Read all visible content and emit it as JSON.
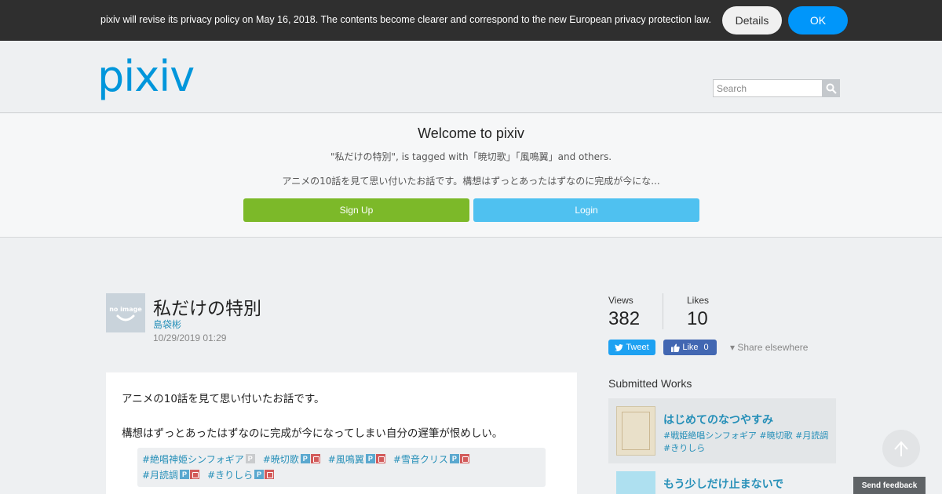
{
  "privacy_bar": {
    "message": "pixiv will revise its privacy policy on May 16, 2018. The contents become clearer and correspond to the new European privacy protection law.",
    "details_label": "Details",
    "ok_label": "OK"
  },
  "header": {
    "logo": "pixiv",
    "search_placeholder": "Search"
  },
  "welcome": {
    "title": "Welcome to pixiv",
    "tags_line": "\"私だけの特別\", is tagged with「暁切歌」「風鳴翼」and others.",
    "description": "アニメの10話を見て思い付いたお話です。構想はずっとあったはずなのに完成が今にな...",
    "signup_label": "Sign Up",
    "login_label": "Login"
  },
  "work": {
    "avatar_text": "no image",
    "title": "私だけの特別",
    "author": "島袋彬",
    "date": "10/29/2019 01:29",
    "caption_1": "アニメの10話を見て思い付いたお話です。",
    "caption_2": "構想はずっとあったはずなのに完成が今になってしまい自分の遅筆が恨めしい。",
    "tags": [
      {
        "text": "#絶唱神姫シンフォギア",
        "p_badge": "grey",
        "lock": false
      },
      {
        "text": "#暁切歌",
        "p_badge": "blue",
        "lock": true
      },
      {
        "text": "#風鳴翼",
        "p_badge": "blue",
        "lock": true
      },
      {
        "text": "#雪音クリス",
        "p_badge": "blue",
        "lock": true
      },
      {
        "text": "#月読調",
        "p_badge": "blue",
        "lock": true
      },
      {
        "text": "#きりしら",
        "p_badge": "blue",
        "lock": true
      }
    ],
    "p_badge_char": "P"
  },
  "stats": {
    "views_label": "Views",
    "views_value": "382",
    "likes_label": "Likes",
    "likes_value": "10"
  },
  "share": {
    "tweet_label": "Tweet",
    "like_label": "Like",
    "like_count": "0",
    "share_else_label": "▾ Share elsewhere"
  },
  "submitted": {
    "heading": "Submitted Works",
    "items": [
      {
        "title": "はじめてのなつやすみ",
        "tags": "#戦姫絶唱シンフォギア #暁切歌 #月読調 #きりしら"
      },
      {
        "title": "もう少しだけ止まないで"
      }
    ]
  },
  "feedback_label": "Send feedback",
  "colors": {
    "brand": "#0096db",
    "ok_button": "#0096fa",
    "signup_button": "#7cb929",
    "login_button": "#4fc1f0",
    "link": "#258fb8",
    "tweet_button": "#1da1f2",
    "fb_like_button": "#4267b2"
  }
}
